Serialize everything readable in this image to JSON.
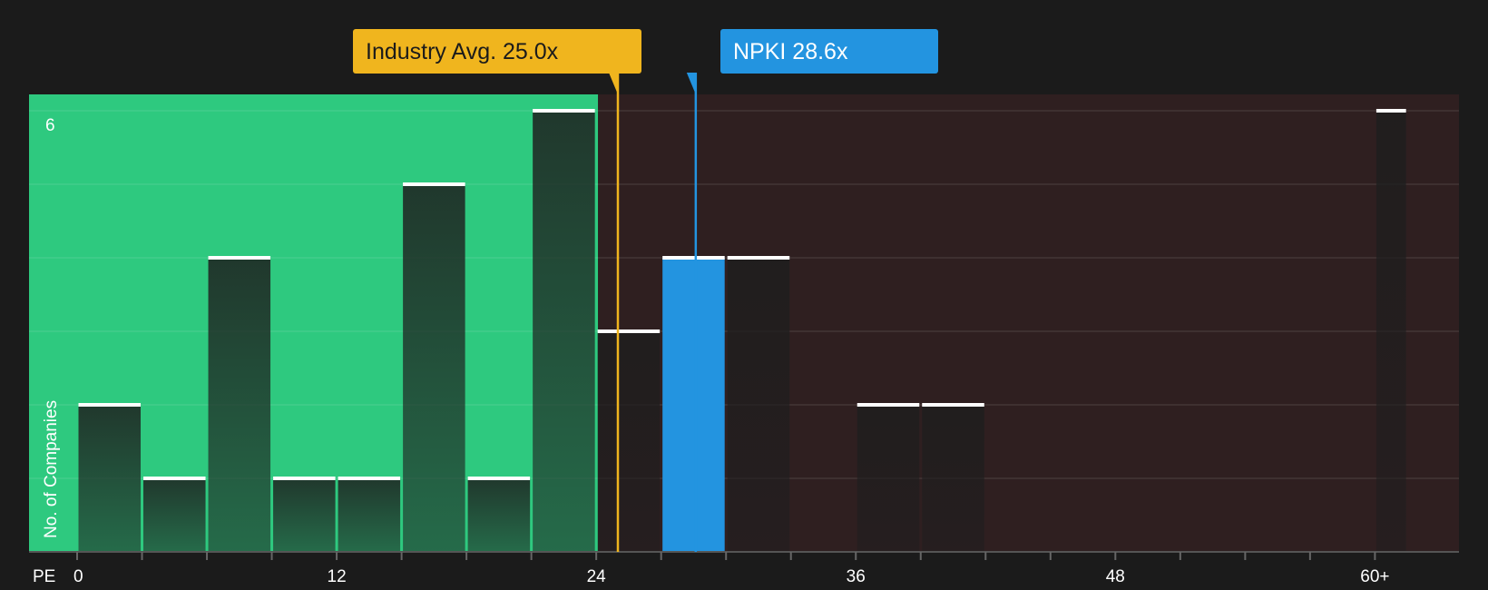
{
  "chart_data": {
    "type": "bar",
    "xlabel": "PE",
    "ylabel": "No. of Companies",
    "x_ticks": [
      "0",
      "12",
      "24",
      "36",
      "48",
      "60+"
    ],
    "x_tick_values": [
      0,
      12,
      24,
      36,
      48,
      60
    ],
    "y_ticks": [
      "6"
    ],
    "y_tick_values": [
      6
    ],
    "xlim": [
      0,
      61.5
    ],
    "ylim": [
      0,
      6.2
    ],
    "bin_width": 3,
    "bins": [
      {
        "start": 0,
        "end": 3,
        "value": 2
      },
      {
        "start": 3,
        "end": 6,
        "value": 1
      },
      {
        "start": 6,
        "end": 9,
        "value": 4
      },
      {
        "start": 9,
        "end": 12,
        "value": 1
      },
      {
        "start": 12,
        "end": 15,
        "value": 1
      },
      {
        "start": 15,
        "end": 18,
        "value": 5
      },
      {
        "start": 18,
        "end": 21,
        "value": 1
      },
      {
        "start": 21,
        "end": 24,
        "value": 6
      },
      {
        "start": 24,
        "end": 27,
        "value": 3
      },
      {
        "start": 27,
        "end": 30,
        "value": 4,
        "highlight": true
      },
      {
        "start": 30,
        "end": 33,
        "value": 4
      },
      {
        "start": 33,
        "end": 36,
        "value": 0
      },
      {
        "start": 36,
        "end": 39,
        "value": 2
      },
      {
        "start": 39,
        "end": 42,
        "value": 2
      },
      {
        "start": 60,
        "end": 61.5,
        "value": 6
      }
    ],
    "industry_avg": {
      "label": "Industry Avg. 25.0x",
      "value": 25.0
    },
    "company": {
      "label": "NPKI 28.6x",
      "value": 28.6
    },
    "green_zone_end": 24,
    "grid": true,
    "colors": {
      "background": "#1b1b1b",
      "green_zone": "#2ec97f",
      "red_zone": "#2f1f20",
      "bar_dark": "#1f1f1f",
      "highlight": "#2394e0",
      "industry": "#f0b51e",
      "bar_top": "#ffffff"
    }
  }
}
